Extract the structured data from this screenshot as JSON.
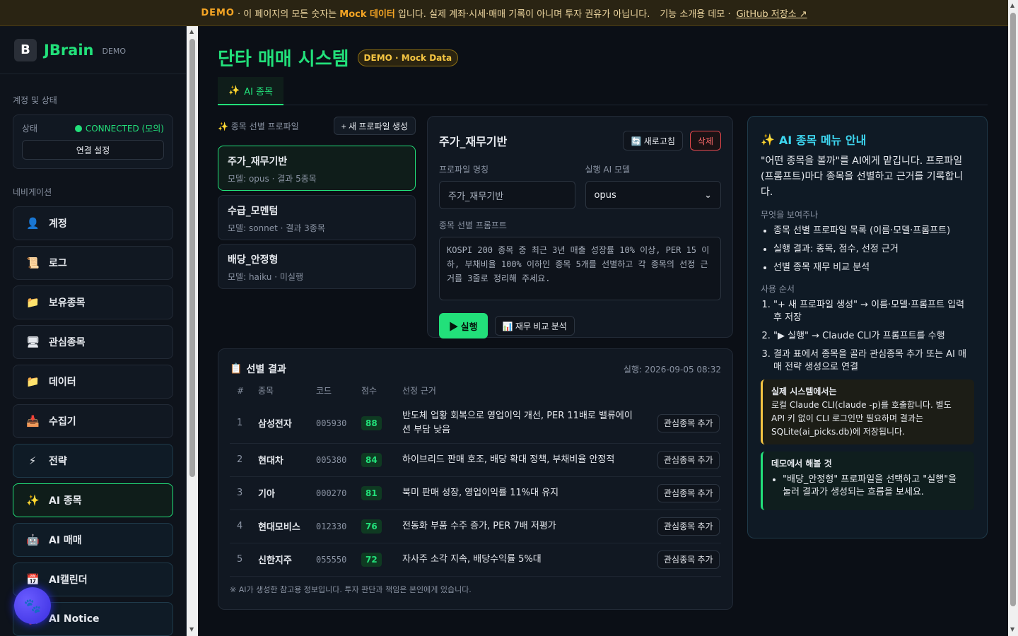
{
  "banner": {
    "demo": "DEMO",
    "text1": "· 이 페이지의 모든 숫자는",
    "mock": "Mock 데이터",
    "text2": "입니다. 실제 계좌·시세·매매 기록이 아니며 투자 권유가 아닙니다.",
    "text3": "기능 소개용 데모 ·",
    "link": "GitHub 저장소 ↗"
  },
  "brand": {
    "logo": "B",
    "name": "JBrain",
    "tag": "DEMO"
  },
  "sidebar": {
    "section_account": "계정 및 상태",
    "status_label": "상태",
    "status_value": "CONNECTED (모의)",
    "connect_btn": "연결 설정",
    "section_nav": "네비게이션",
    "items": [
      {
        "icon": "👤",
        "label": "계정"
      },
      {
        "icon": "📜",
        "label": "로그"
      },
      {
        "icon": "📁",
        "label": "보유종목"
      },
      {
        "icon": "🖥",
        "label": "관심종목"
      },
      {
        "icon": "📁",
        "label": "데이터"
      },
      {
        "icon": "📥",
        "label": "수집기"
      },
      {
        "icon": "⚡",
        "label": "전략"
      },
      {
        "icon": "✨",
        "label": "AI 종목"
      },
      {
        "icon": "🤖",
        "label": "AI 매매"
      },
      {
        "icon": "📅",
        "label": "AI캘린더"
      },
      {
        "icon": "📢",
        "label": "AI Notice"
      }
    ]
  },
  "page": {
    "title": "단타 매매 시스템",
    "badge": "DEMO · Mock Data"
  },
  "tabs": [
    {
      "icon": "✨",
      "label": "AI 종목"
    }
  ],
  "profiles": {
    "label": "종목 선별 프로파일",
    "new_btn": "+ 새 프로파일 생성",
    "items": [
      {
        "name": "주가_재무기반",
        "meta": "모델: opus · 결과 5종목"
      },
      {
        "name": "수급_모멘텀",
        "meta": "모델: sonnet · 결과 3종목"
      },
      {
        "name": "배당_안정형",
        "meta": "모델: haiku · 미실행"
      }
    ]
  },
  "editor": {
    "title": "주가_재무기반",
    "refresh_btn": "새로고침",
    "delete_btn": "삭제",
    "name_label": "프로파일 명칭",
    "name_value": "주가_재무기반",
    "model_label": "실행 AI 모델",
    "model_value": "opus",
    "prompt_label": "종목 선별 프롬프트",
    "prompt_value": "KOSPI 200 종목 중 최근 3년 매출 성장률 10% 이상, PER 15 이하, 부채비율 100% 이하인 종목 5개를 선별하고 각 종목의 선정 근거를 3줄로 정리해 주세요.",
    "run_btn": "실행",
    "compare_btn": "재무 비교 분석"
  },
  "results": {
    "title": "선별 결과",
    "run_time": "실행: 2026-09-05 08:32",
    "headers": [
      "#",
      "종목",
      "코드",
      "점수",
      "선정 근거"
    ],
    "add_btn": "관심종목 추가",
    "rows": [
      {
        "no": "1",
        "name": "삼성전자",
        "code": "005930",
        "score": "88",
        "reason": "반도체 업황 회복으로 영업이익 개선, PER 11배로 밸류에이션 부담 낮음"
      },
      {
        "no": "2",
        "name": "현대차",
        "code": "005380",
        "score": "84",
        "reason": "하이브리드 판매 호조, 배당 확대 정책, 부채비율 안정적"
      },
      {
        "no": "3",
        "name": "기아",
        "code": "000270",
        "score": "81",
        "reason": "북미 판매 성장, 영업이익률 11%대 유지"
      },
      {
        "no": "4",
        "name": "현대모비스",
        "code": "012330",
        "score": "76",
        "reason": "전동화 부품 수주 증가, PER 7배 저평가"
      },
      {
        "no": "5",
        "name": "신한지주",
        "code": "055550",
        "score": "72",
        "reason": "자사주 소각 지속, 배당수익률 5%대"
      }
    ],
    "note": "※ AI가 생성한 참고용 정보입니다. 투자 판단과 책임은 본인에게 있습니다."
  },
  "guide": {
    "title": "AI 종목 메뉴 안내",
    "intro": "\"어떤 종목을 볼까\"를 AI에게 맡깁니다. 프로파일(프롬프트)마다 종목을 선별하고 근거를 기록합니다.",
    "what_label": "무엇을 보여주나",
    "what_items": [
      "종목 선별 프로파일 목록 (이름·모델·프롬프트)",
      "실행 결과: 종목, 점수, 선정 근거",
      "선별 종목 재무 비교 분석"
    ],
    "order_label": "사용 순서",
    "order_items": [
      "\"+ 새 프로파일 생성\" → 이름·모델·프롬프트 입력 후 저장",
      "\"▶ 실행\" → Claude CLI가 프롬프트를 수행",
      "결과 표에서 종목을 골라 관심종목 추가 또는 AI 매매 전략 생성으로 연결"
    ],
    "warn_title": "실제 시스템에서는",
    "warn_text": "로컬 Claude CLI(claude -p)를 호출합니다. 별도 API 키 없이 CLI 로그인만 필요하며 결과는 SQLite(ai_picks.db)에 저장됩니다.",
    "try_title": "데모에서 해볼 것",
    "try_text": "\"배당_안정형\" 프로파일을 선택하고 \"실행\"을 눌러 결과가 생성되는 흐름을 보세요."
  }
}
